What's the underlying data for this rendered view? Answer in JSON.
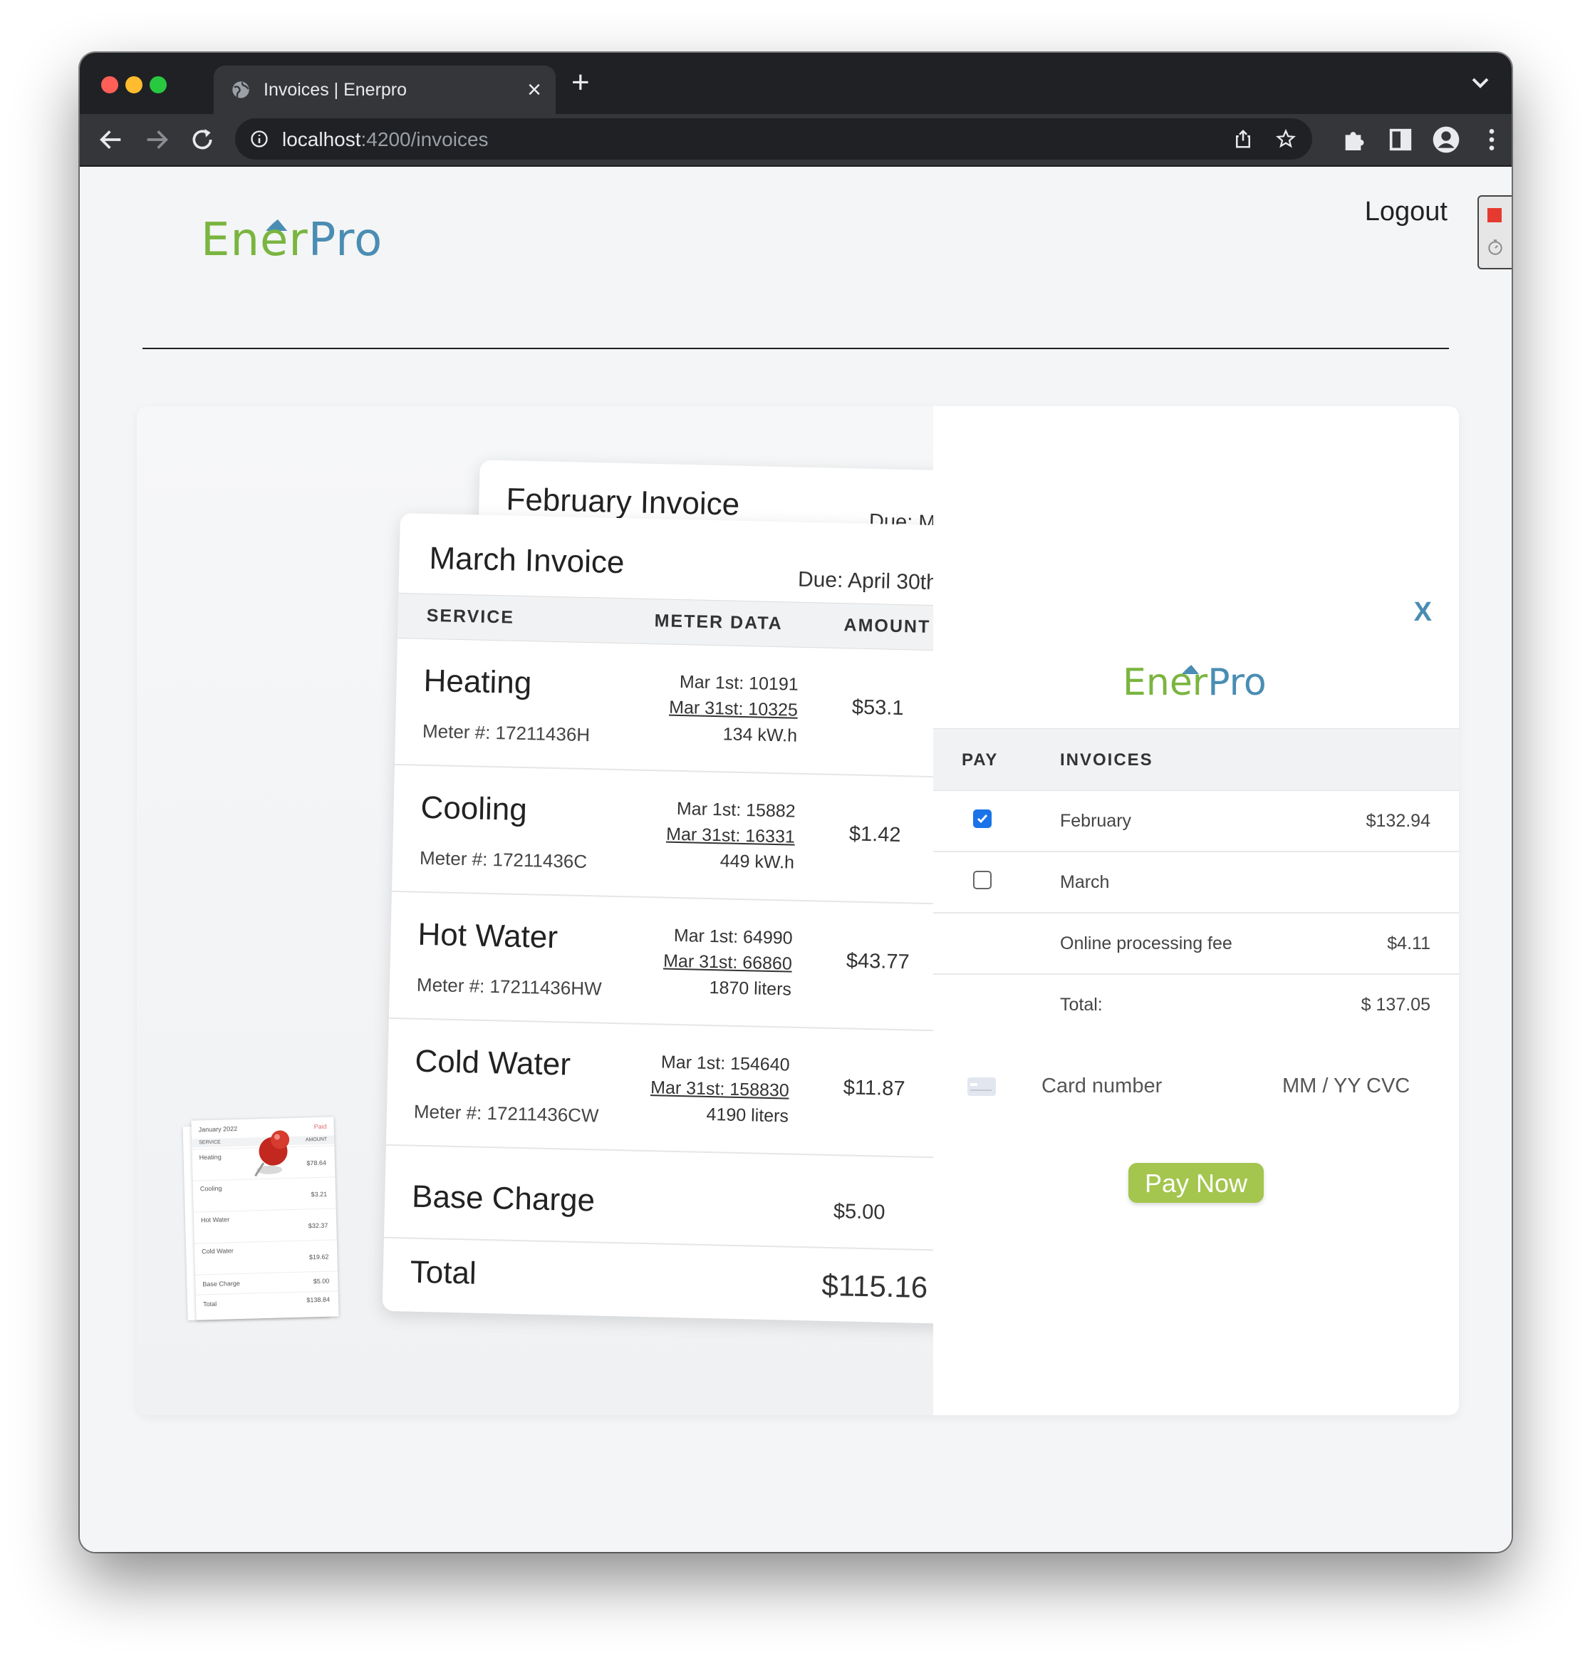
{
  "browser": {
    "tab_title": "Invoices | Enerpro",
    "url_host": "localhost",
    "url_path": ":4200/invoices"
  },
  "header": {
    "logo_ener": "Ener",
    "logo_pro": "Pro",
    "logout_label": "Logout"
  },
  "colors": {
    "brand_green": "#7ab53f",
    "brand_blue": "#4a8db3",
    "pay_button": "#a4c54e",
    "checkbox_checked": "#1a73e8"
  },
  "february_invoice": {
    "title": "February Invoice",
    "due": "Due: M"
  },
  "march_invoice": {
    "title": "March Invoice",
    "due": "Due: April 30th",
    "columns": [
      "SERVICE",
      "METER DATA",
      "AMOUNT"
    ],
    "rows": [
      {
        "service": "Heating",
        "meter": "Meter #: 17211436H",
        "start": "Mar 1st: 10191",
        "end": "Mar 31st: 10325",
        "usage": "134 kW.h",
        "amount": "$53.1"
      },
      {
        "service": "Cooling",
        "meter": "Meter #: 17211436C",
        "start": "Mar 1st: 15882",
        "end": "Mar 31st: 16331",
        "usage": "449 kW.h",
        "amount": "$1.42"
      },
      {
        "service": "Hot Water",
        "meter": "Meter #: 17211436HW",
        "start": "Mar 1st: 64990",
        "end": "Mar 31st: 66860",
        "usage": "1870 liters",
        "amount": "$43.77"
      },
      {
        "service": "Cold Water",
        "meter": "Meter #: 17211436CW",
        "start": "Mar 1st: 154640",
        "end": "Mar 31st: 158830",
        "usage": "4190 liters",
        "amount": "$11.87"
      }
    ],
    "base_charge_label": "Base Charge",
    "base_charge_amount": "$5.00",
    "total_label": "Total",
    "total_amount": "$115.16"
  },
  "thumbnail": {
    "title": "January 2022",
    "status": "Paid",
    "col_service": "SERVICE",
    "col_amount": "AMOUNT",
    "rows": [
      {
        "service": "Heating",
        "amount": "$78.64"
      },
      {
        "service": "Cooling",
        "amount": "$3.21"
      },
      {
        "service": "Hot Water",
        "amount": "$32.37"
      },
      {
        "service": "Cold Water",
        "amount": "$19.62"
      },
      {
        "service": "Base Charge",
        "amount": "$5.00"
      },
      {
        "service": "Total",
        "amount": "$138.84"
      }
    ]
  },
  "payment": {
    "close_label": "X",
    "col_pay": "PAY",
    "col_invoices": "INVOICES",
    "items": [
      {
        "label": "February",
        "amount": "$132.94",
        "checked": true
      },
      {
        "label": "March",
        "amount": "",
        "checked": false
      }
    ],
    "fee_label": "Online processing fee",
    "fee_amount": "$4.11",
    "total_label": "Total:",
    "total_amount": "$ 137.05",
    "card_number_placeholder": "Card number",
    "expiry_placeholder": "MM / YY",
    "cvc_placeholder": "CVC",
    "pay_button_label": "Pay Now"
  }
}
